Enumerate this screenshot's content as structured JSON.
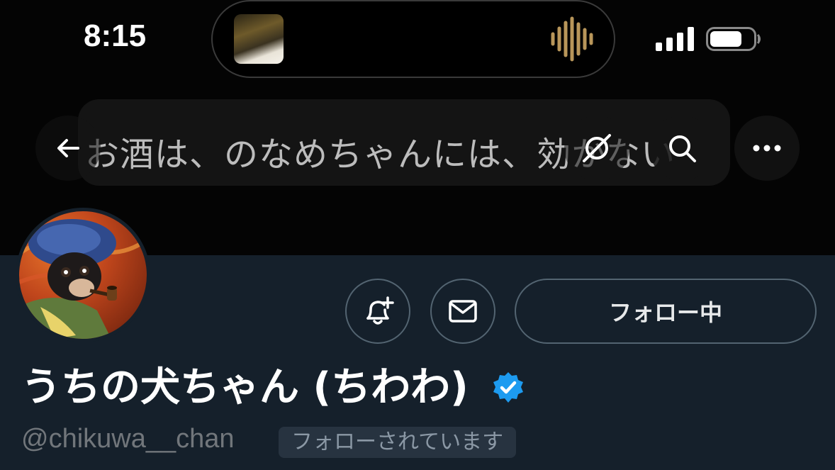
{
  "status_bar": {
    "time": "8:15",
    "icons": [
      "now-playing-artwork",
      "audio-waveform-icon",
      "signal-icon",
      "battery-icon"
    ]
  },
  "header": {
    "banner_text": "お酒は、のなめちゃんには、効かない",
    "buttons": [
      "back-arrow-icon",
      "grok-icon",
      "search-icon",
      "more-icon"
    ]
  },
  "profile": {
    "display_name": "うちの犬ちゃん (ちわわ)",
    "verified": true,
    "handle": "@chikuwa__chan",
    "follows_you_label": "フォローされています",
    "follow_button_label": "フォロー中",
    "action_icons": [
      "notification-bell-plus-icon",
      "mail-icon"
    ]
  },
  "colors": {
    "background": "#15202b",
    "banner": "#040404",
    "border": "#536471",
    "handle": "#71767b",
    "verified": "#1d9bf0",
    "badge_bg": "#273340"
  }
}
